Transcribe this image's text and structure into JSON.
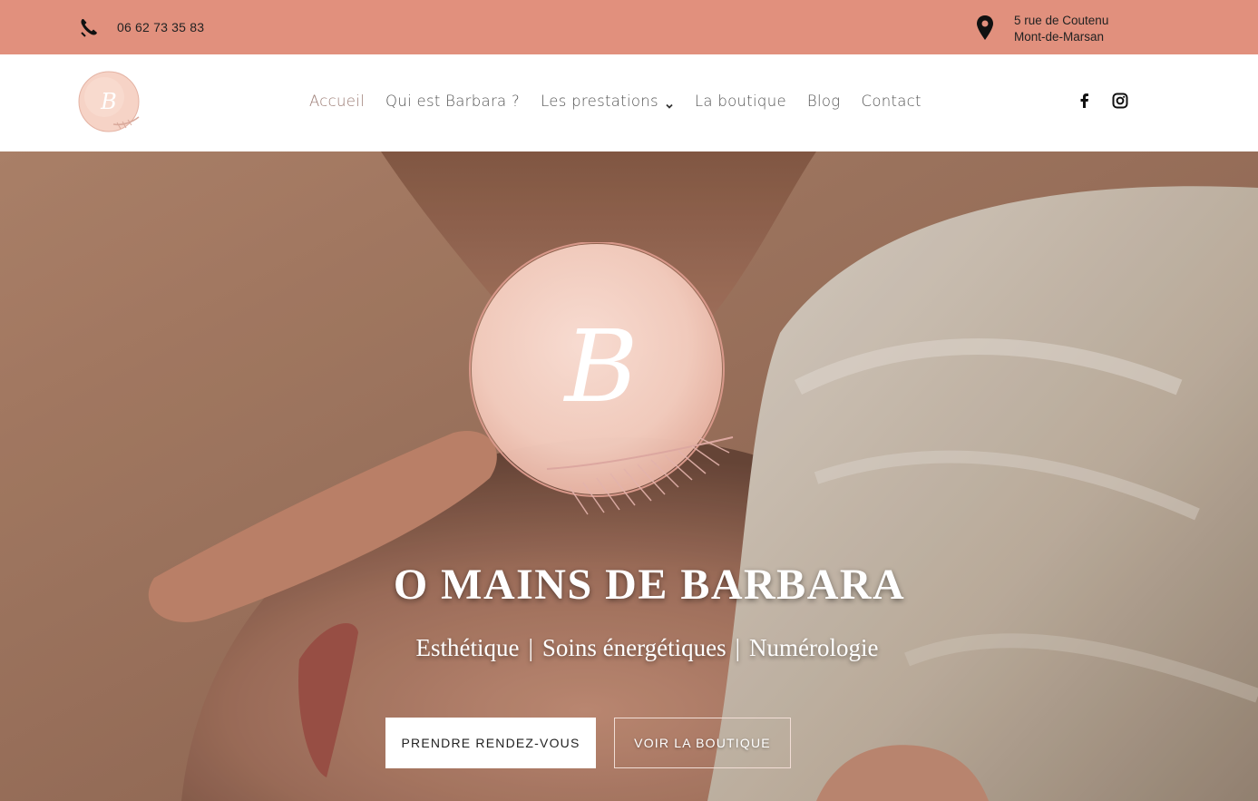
{
  "topbar": {
    "phone": "06 62 73 35 83",
    "address_line1": "5 rue de Coutenu",
    "address_line2": "Mont-de-Marsan",
    "background_color": "#e1907d"
  },
  "nav": {
    "items": [
      {
        "label": "Accueil"
      },
      {
        "label": "Qui est Barbara ?"
      },
      {
        "label": "Les prestations"
      },
      {
        "label": "La boutique"
      },
      {
        "label": "Blog"
      },
      {
        "label": "Contact"
      }
    ],
    "active": "Accueil",
    "social_icons": [
      "facebook-icon",
      "instagram-icon"
    ]
  },
  "hero": {
    "title": "O MAINS DE BARBARA",
    "subtitle_parts": [
      "Esthétique",
      "Soins énergétiques",
      "Numérologie"
    ],
    "separator": "|",
    "primary_button": "PRENDRE RENDEZ-VOUS",
    "secondary_button": "VOIR LA BOUTIQUE",
    "logo_letter": "B"
  }
}
